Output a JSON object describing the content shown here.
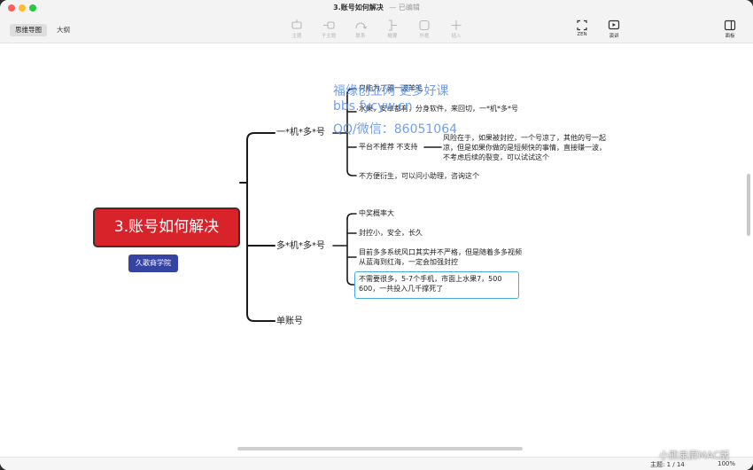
{
  "window": {
    "title": "3.账号如何解决",
    "subtitle": "— 已编辑"
  },
  "toolbar": {
    "view_tabs": [
      "思维导图",
      "大纲"
    ],
    "tools": {
      "topic": "主题",
      "subtopic": "子主题",
      "relation": "联系",
      "summary": "概要",
      "boundary": "外框",
      "insert": "插入",
      "zen": "ZEN",
      "present": "演讲",
      "panel": "面板"
    }
  },
  "mindmap": {
    "root": "3.账号如何解决",
    "tag": "久歌商学院",
    "branch1": {
      "label": "一*机*多*号",
      "items": [
        "只能为了薅一波羊毛",
        "水果，安卓都有，分身软件，来回切，一*机*多*号",
        "平台不推荐 不支持",
        "不方便衍生，可以问小助理，咨询这个"
      ],
      "note": "风险在于，如果被封控，一个号凉了，其他的号一起凉，但是如果你做的是短频快的事情，直接赚一波，不考虑后续的裂变，可以试试这个"
    },
    "branch2": {
      "label": "多*机*多*号",
      "items": [
        "中奖概率大",
        "封控小，安全，长久",
        "目前多多系统风口其实并不严格，但是随着多多视频从蓝海到红海，一定会加强封控",
        "不需要很多，5-7个手机，市面上水果7，500 600，一共投入几千撑死了"
      ]
    },
    "branch3": {
      "label": "单账号"
    }
  },
  "watermark": {
    "line1": "福缘创业网 更多好课",
    "line2": "bbs.fycyw.cn",
    "line3": "QQ/微信：86051064",
    "corner": "小熊录屏MAC版"
  },
  "status": {
    "topic_count": "主题: 1 / 14",
    "zoom": "100%"
  }
}
